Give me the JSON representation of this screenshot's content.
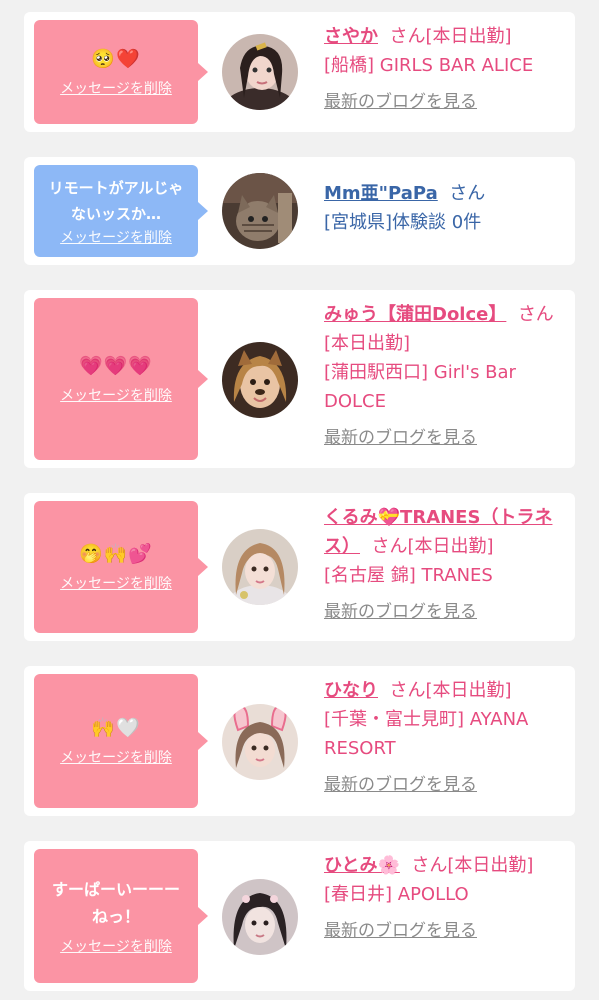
{
  "delete_label": "メッセージを削除",
  "blog_label": "最新のブログを見る",
  "san_label": "さん",
  "cards": [
    {
      "message": "🥺❤️",
      "name": "さやか",
      "suffix": "さん[本日出勤]",
      "shop": "[船橋] GIRLS BAR ALICE"
    },
    {
      "message": "リモートがアルじゃないッスか…",
      "name": "Mm亜\"PaPa",
      "suffix": "さん",
      "shop": "[宮城県]体験談 0件"
    },
    {
      "message": "💗💗💗",
      "name": "みゅう【蒲田Dolce】",
      "suffix": "さん[本日出勤]",
      "shop": "[蒲田駅西口] Girl's Bar DOLCE"
    },
    {
      "message": "🤭🙌💕",
      "name": "くるみ💝TRANES（トラネス）",
      "suffix": "さん[本日出勤]",
      "shop": "[名古屋 錦] TRANES"
    },
    {
      "message": "🙌🤍",
      "name": "ひなり",
      "suffix": "さん[本日出勤]",
      "shop": "[千葉・富士見町] AYANA RESORT"
    },
    {
      "message": "すーぱーいーーーねっ！",
      "name": "ひとみ🌸",
      "suffix": "さん[本日出勤]",
      "shop": "[春日井] APOLLO"
    }
  ],
  "colors": {
    "pink_bubble": "#fb94a4",
    "blue_bubble": "#8db8f6",
    "pink_text": "#e64b7f",
    "blue_text": "#3a66a7",
    "background": "#f1f1f1"
  }
}
